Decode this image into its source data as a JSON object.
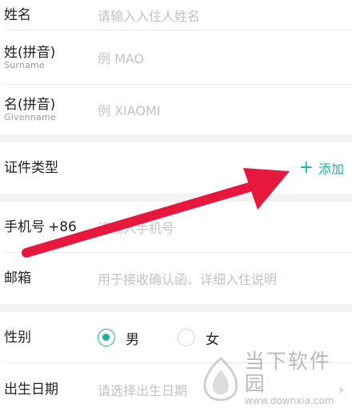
{
  "form": {
    "name": {
      "label": "姓名",
      "placeholder": "请输入入住人姓名"
    },
    "surname": {
      "label": "姓(拼音)",
      "sub_label": "Surname",
      "placeholder": "例 MAO"
    },
    "givenname": {
      "label": "名(拼音)",
      "sub_label": "Givenname",
      "placeholder": "例 XIAOMI"
    },
    "id_type": {
      "label": "证件类型",
      "add_label": "添加"
    },
    "phone": {
      "label": "手机号",
      "prefix": "+86",
      "placeholder": "请输入手机号"
    },
    "email": {
      "label": "邮箱",
      "placeholder": "用于接收确认函、详细入住说明"
    },
    "gender": {
      "label": "性别",
      "options": [
        "男",
        "女"
      ],
      "selected": "男"
    },
    "birthday": {
      "label": "出生日期",
      "placeholder": "请选择出生日期"
    }
  },
  "watermark": {
    "name": "当下软件园",
    "url": "www.downxia.com"
  },
  "colors": {
    "accent": "#1bb39b",
    "arrow": "#e8173d",
    "placeholder": "#c3c3c3"
  },
  "icons": {
    "add": "plus-icon",
    "radio_checked": "radio-checked-icon",
    "radio_unchecked": "radio-unchecked-icon",
    "chevron": "chevron-right-icon",
    "annotation": "red-arrow-icon"
  }
}
